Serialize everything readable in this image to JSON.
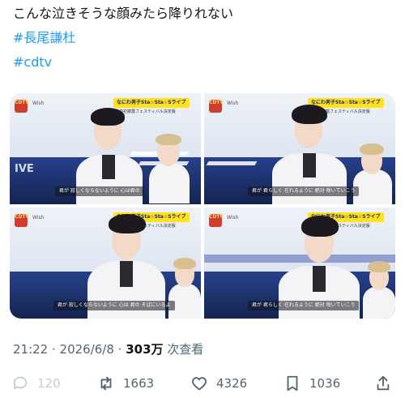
{
  "post": {
    "text": "こんな泣きそうな顔みたら降りれない",
    "hashtags": [
      "#長尾謙杜",
      "#cdtv"
    ]
  },
  "media": [
    {
      "song": "Wish",
      "banner": "なにわ男子Sta☆Sta☆Sライブ",
      "banner_sub": "新曲初披露フェスティバル決定版",
      "caption": "君が 寂しくならないように 心は君の",
      "side_text": "IVE"
    },
    {
      "song": "Wish",
      "banner": "なにわ男子Sta☆Sta☆Sライブ",
      "banner_sub": "新曲初披露フェスティバル決定版",
      "caption": "君が 君らしく 在れるように 絶対 咲いていこう"
    },
    {
      "song": "Wish",
      "banner": "なにわ男子Sta☆Sta☆Sライブ",
      "banner_sub": "新曲初披露フェスティバル決定版",
      "caption": "君が 寂しくならないように 心は 君の そばにいるよ"
    },
    {
      "song": "Wish",
      "banner": "なにわ男子Sta☆Sta☆Sライブ",
      "banner_sub": "新曲初披露フェスティバル決定版",
      "caption": "君が 君らしく 在れるように 絶対 咲いていこう"
    }
  ],
  "meta": {
    "time_date": "21:22 · 2026/6/8 · ",
    "views_count": "303万",
    "views_label": " 次查看"
  },
  "actions": {
    "reply_count": "120",
    "repost_count": "1663",
    "like_count": "4326",
    "bookmark_count": "1036"
  },
  "colors": {
    "accent": "#1d9bf0",
    "text": "#0f1419",
    "muted": "#536471",
    "dimmed": "#c5cdd3"
  }
}
